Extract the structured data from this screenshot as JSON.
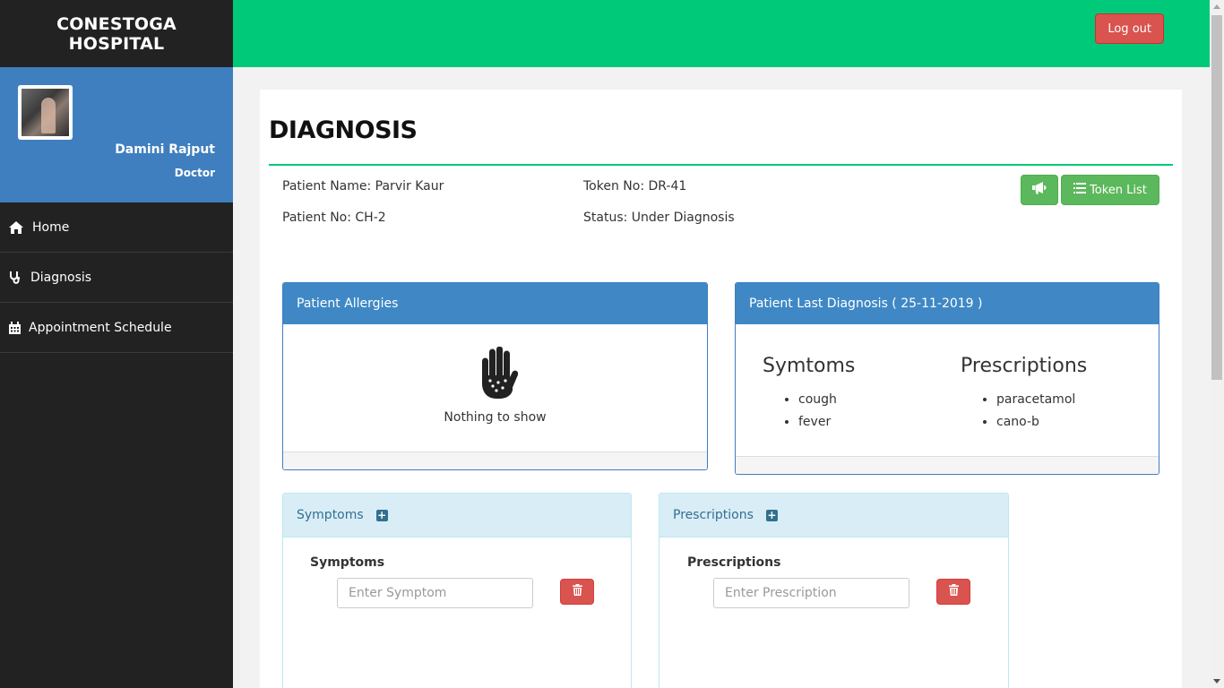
{
  "sidebar": {
    "brand_line1": "CONESTOGA",
    "brand_line2": "HOSPITAL",
    "user_name": "Damini Rajput",
    "user_role": "Doctor",
    "nav": [
      {
        "label": "Home",
        "icon": "home-icon"
      },
      {
        "label": "Diagnosis",
        "icon": "stethoscope-icon"
      },
      {
        "label": "Appointment Schedule",
        "icon": "calendar-icon"
      }
    ]
  },
  "topbar": {
    "logout_label": "Log out"
  },
  "page": {
    "title": "DIAGNOSIS",
    "patient_name": "Patient Name: Parvir Kaur",
    "token_no": "Token No: DR-41",
    "patient_no": "Patient No: CH-2",
    "status": "Status: Under Diagnosis",
    "announce_icon": "bullhorn-icon",
    "token_list_label": "Token List"
  },
  "allergies": {
    "title": "Patient Allergies",
    "empty_text": "Nothing to show",
    "icon": "hand-allergy-icon"
  },
  "last_diagnosis": {
    "title": "Patient Last Diagnosis ( 25-11-2019 )",
    "symptoms_title": "Symtoms",
    "symptoms": [
      "cough",
      "fever"
    ],
    "prescriptions_title": "Prescriptions",
    "prescriptions": [
      "paracetamol",
      "cano-b"
    ]
  },
  "symptoms_panel": {
    "title": "Symptoms",
    "field_label": "Symptoms",
    "placeholder": "Enter Symptom"
  },
  "prescriptions_panel": {
    "title": "Prescriptions",
    "field_label": "Prescriptions",
    "placeholder": "Enter Prescription"
  },
  "colors": {
    "sidebar_bg": "#222222",
    "profile_bg": "#3f7fbf",
    "topbar_bg": "#00c979",
    "danger": "#d9534f",
    "success": "#5cb85c",
    "panel_primary": "#3f88c5",
    "panel_info": "#d9edf7"
  }
}
